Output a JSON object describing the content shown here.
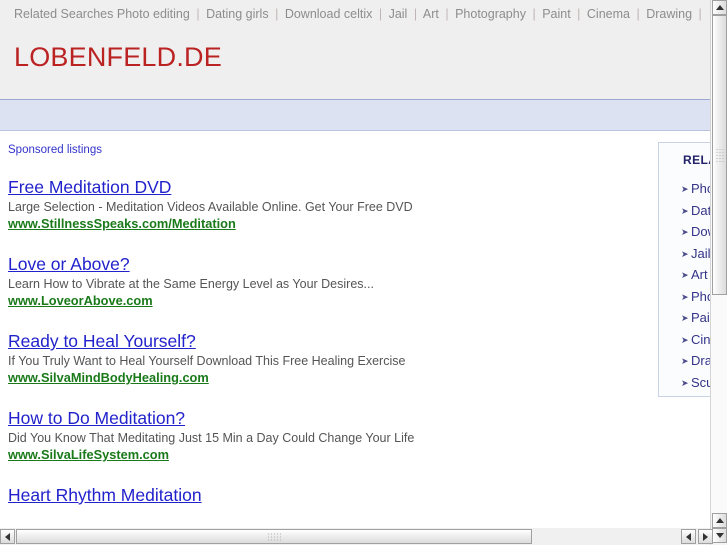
{
  "header": {
    "nav_label": "Related Searches",
    "nav_links": [
      "Photo editing",
      "Dating girls",
      "Download celtix",
      "Jail",
      "Art",
      "Photography",
      "Paint",
      "Cinema",
      "Drawing"
    ],
    "nav_separator": "|",
    "logo": "LOBENFELD.DE"
  },
  "main": {
    "sponsored_label": "Sponsored listings",
    "ads": [
      {
        "title": "Free Meditation DVD",
        "description": "Large Selection - Meditation Videos Available Online. Get Your Free DVD",
        "url": "www.StillnessSpeaks.com/Meditation"
      },
      {
        "title": "Love or Above?",
        "description": "Learn How to Vibrate at the Same Energy Level as Your Desires...",
        "url": "www.LoveorAbove.com"
      },
      {
        "title": "Ready to Heal Yourself?",
        "description": "If You Truly Want to Heal Yourself Download This Free Healing Exercise",
        "url": "www.SilvaMindBodyHealing.com"
      },
      {
        "title": "How to Do Meditation?",
        "description": "Did You Know That Meditating Just 15 Min a Day Could Change Your Life",
        "url": "www.SilvaLifeSystem.com"
      },
      {
        "title": "Heart Rhythm Meditation",
        "description": "",
        "url": ""
      }
    ]
  },
  "sidebar": {
    "title": "RELATED SEARCHES",
    "bullet": "➤",
    "items": [
      "Photo editing",
      "Dating girls",
      "Download celtix",
      "Jail",
      "Art",
      "Photography",
      "Paint",
      "Cinema",
      "Drawing",
      "Sculpture"
    ]
  },
  "colors": {
    "logo": "#bb2222",
    "ad_title": "#2222cc",
    "ad_url": "#1a7a1a",
    "sponsored": "#3333cc",
    "banner_band": "#dce2f2",
    "header_bg": "#efefef"
  }
}
